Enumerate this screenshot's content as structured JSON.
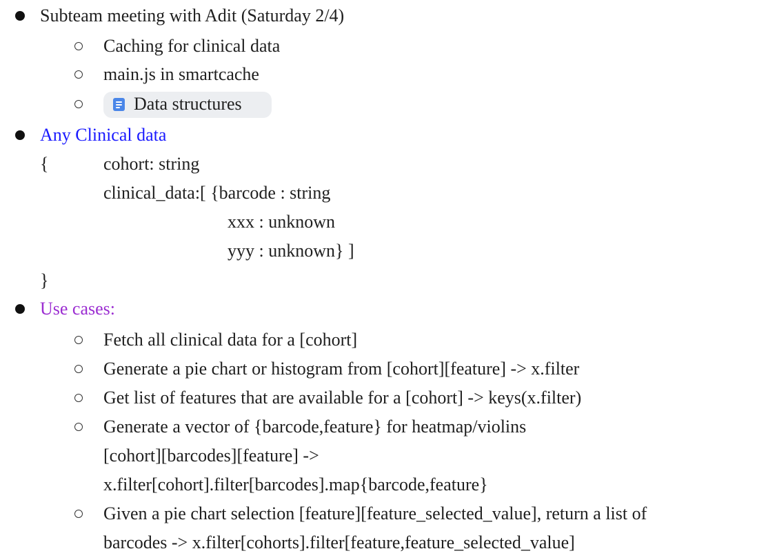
{
  "colors": {
    "heading_blue": "#1a1aff",
    "heading_purple": "#9b2dd1",
    "chip_background": "#eceef1",
    "doc_icon": "#4a86e8"
  },
  "meeting": {
    "title": "Subteam meeting with Adit (Saturday 2/4)",
    "items": [
      "Caching for clinical data",
      "main.js in smartcache"
    ],
    "doc_chip": {
      "icon": "document-icon",
      "label": "Data structures"
    }
  },
  "clinical": {
    "title": "Any Clinical data",
    "brace_open": "{",
    "cohort_line": "cohort: string",
    "clinical_data_line": "clinical_data:[ {barcode : string",
    "xxx_line": "xxx : unknown",
    "yyy_line": "yyy : unknown} ]",
    "brace_close": "}"
  },
  "use_cases": {
    "title": "Use cases:",
    "items": [
      "Fetch all clinical data for a [cohort]",
      "Generate a pie chart or histogram from [cohort][feature] -> x.filter",
      "Get list of features that are available for a [cohort] -> keys(x.filter)",
      "Generate a vector of {barcode,feature} for heatmap/violins",
      "[cohort][barcodes][feature] ->",
      "x.filter[cohort].filter[barcodes].map{barcode,feature}",
      "Given a pie chart selection [feature][feature_selected_value], return a list of",
      "barcodes -> x.filter[cohorts].filter[feature,feature_selected_value]"
    ]
  }
}
